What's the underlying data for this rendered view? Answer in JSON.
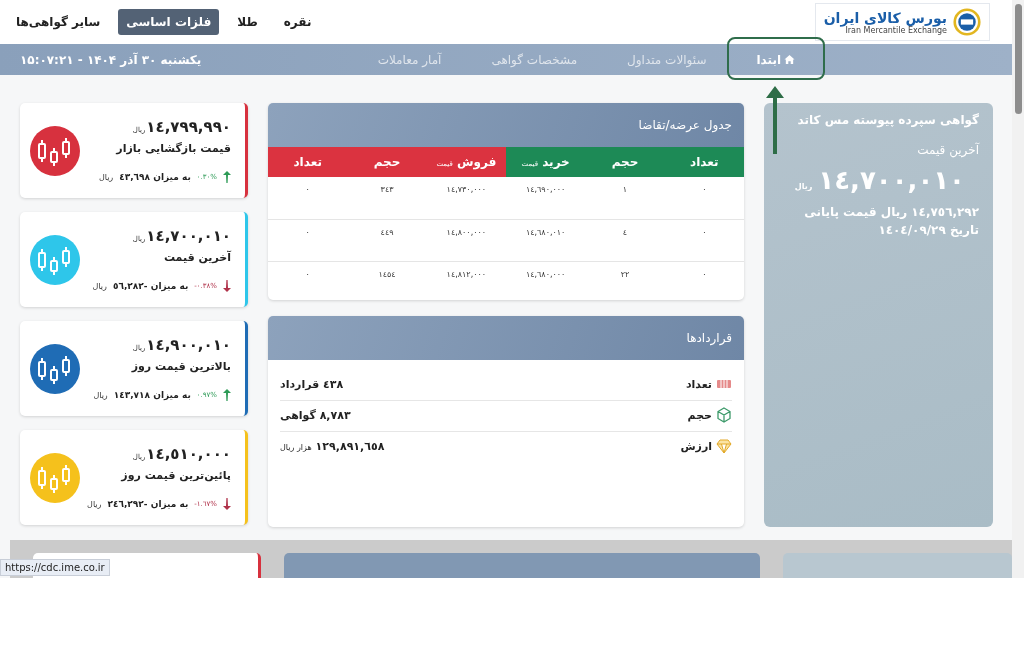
{
  "header": {
    "logo": {
      "title": "بورس کالای ایران",
      "subtitle": "Iran Mercantile Exchange"
    },
    "tabs": [
      {
        "label": "نقره",
        "selected": false
      },
      {
        "label": "طلا",
        "selected": false
      },
      {
        "label": "فلزات اساسی",
        "selected": true
      },
      {
        "label": "سایر گواهی‌ها",
        "selected": false
      }
    ]
  },
  "nav": {
    "items": [
      {
        "label": "ابتدا",
        "selected": true,
        "kind": "home"
      },
      {
        "label": "سئوالات متداول",
        "selected": false,
        "kind": "text"
      },
      {
        "label": "مشخصات گواهی",
        "selected": false,
        "kind": "text"
      },
      {
        "label": "آمار معاملات",
        "selected": false,
        "kind": "text"
      }
    ],
    "datetime": "یکشنبه ۳۰ آذر ۱۴۰۴ - ۱۵:۰۷:۲۱"
  },
  "annotation": {
    "highlight_frame": true,
    "arrow": true
  },
  "summary": {
    "title": "گواهی سپرده پیوسته مس کاتد",
    "label": "آخرین قیمت",
    "price": "١٤,٧٠٠,٠١٠",
    "unit": "ریال",
    "note": "١٤,٧٥٦,٢٩٢ ریال قیمت پایانی تاریخ ١٤٠٤/٠٩/٢٩"
  },
  "order_book": {
    "title": "جدول عرضه/تقاضا",
    "columns": [
      {
        "label": "تعداد",
        "kind": "buy"
      },
      {
        "label": "حجم",
        "kind": "buy"
      },
      {
        "label": "خرید",
        "note": "قیمت",
        "kind": "buy"
      },
      {
        "label": "فروش",
        "note": "قیمت",
        "kind": "sell"
      },
      {
        "label": "حجم",
        "kind": "sell"
      },
      {
        "label": "تعداد",
        "kind": "sell"
      }
    ],
    "rows": [
      [
        "٠",
        "١",
        "١٤,٦٩٠,٠٠٠",
        "١٤,٧٣٠,٠٠٠",
        "٣٤٣",
        "٠"
      ],
      [
        "٠",
        "٤",
        "١٤,٦٨٠,٠١٠",
        "١٤,٨٠٠,٠٠٠",
        "٤٤٩",
        "٠"
      ],
      [
        "٠",
        "٢٢",
        "١٤,٦٨٠,٠٠٠",
        "١٤,٨١٢,٠٠٠",
        "١٤٥٤",
        "٠"
      ]
    ]
  },
  "contracts": {
    "title": "قراردادها",
    "rows": [
      {
        "kind": "counter",
        "label": "تعداد",
        "value": "٤٣٨ قرارداد"
      },
      {
        "kind": "cube",
        "label": "حجم",
        "value": "٨,٧٨٣ گواهی"
      },
      {
        "kind": "diamond",
        "label": "ارزش",
        "value": "١٢٩,٨٩١,٦٥٨",
        "unit": "هزار ریال"
      }
    ]
  },
  "stats": [
    {
      "label": "قیمت بازگشایی بازار",
      "price": "١٤,٧٩٩,٩٩٠",
      "unit": "ریال",
      "kind": "up",
      "percent": "٠.٣٠%",
      "change": "به میزان ٤٣,٦٩٨",
      "change_unit": "ریال",
      "color": "#d7313e"
    },
    {
      "label": "آخرین قیمت",
      "price": "١٤,٧٠٠,٠١٠",
      "unit": "ریال",
      "kind": "down",
      "percent": "-٠.٣٨%",
      "change": "به میزان -٥٦,٢٨٢",
      "change_unit": "ریال",
      "color": "#2ec6ea"
    },
    {
      "label": "بالاترین قیمت روز",
      "price": "١٤,٩٠٠,٠١٠",
      "unit": "ریال",
      "kind": "up",
      "percent": "٠.٩٧%",
      "change": "به میزان ١٤٣,٧١٨",
      "change_unit": "ریال",
      "color": "#1f6cb5"
    },
    {
      "label": "پائین‌ترین قیمت روز",
      "price": "١٤,٥١٠,٠٠٠",
      "unit": "ریال",
      "kind": "down",
      "percent": "-١.٦٧%",
      "change": "به میزان -٢٤٦,٢٩٢",
      "change_unit": "ریال",
      "color": "#f5c11c"
    }
  ],
  "status_url": "https://cdc.ime.co.ir"
}
